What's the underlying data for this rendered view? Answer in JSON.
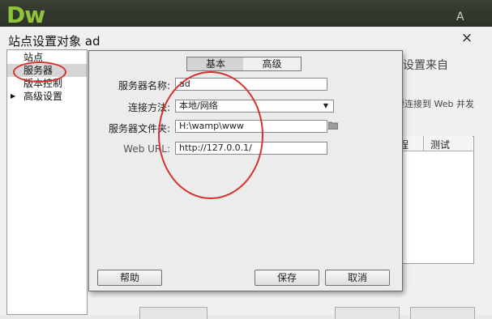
{
  "app": {
    "logo": "Dw",
    "adobe_mark": "A"
  },
  "site_dialog": {
    "title": "站点设置对象 ad",
    "close": "×",
    "sidebar": [
      {
        "label": "站点",
        "selected": false,
        "expandable": false
      },
      {
        "label": "服务器",
        "selected": true,
        "expandable": false
      },
      {
        "label": "版本控制",
        "selected": false,
        "expandable": false
      },
      {
        "label": "高级设置",
        "selected": false,
        "expandable": true
      }
    ],
    "right_text_1": "设置来自",
    "right_text_2": "要连接到 Web 并发",
    "table_headers": [
      "程",
      "测试"
    ]
  },
  "server_dialog": {
    "tabs": {
      "basic": "基本",
      "advanced": "高级"
    },
    "fields": {
      "server_name": {
        "label": "服务器名称:",
        "value": "ad"
      },
      "connect_method": {
        "label": "连接方法:",
        "value": "本地/网络"
      },
      "server_folder": {
        "label": "服务器文件夹:",
        "value": "H:\\wamp\\www"
      },
      "web_url": {
        "label": "Web URL:",
        "value": "http://127.0.0.1/"
      }
    },
    "buttons": {
      "help": "帮助",
      "save": "保存",
      "cancel": "取消"
    }
  },
  "colors": {
    "annotation": "#d4332f",
    "logo_green": "#8fc43a"
  }
}
